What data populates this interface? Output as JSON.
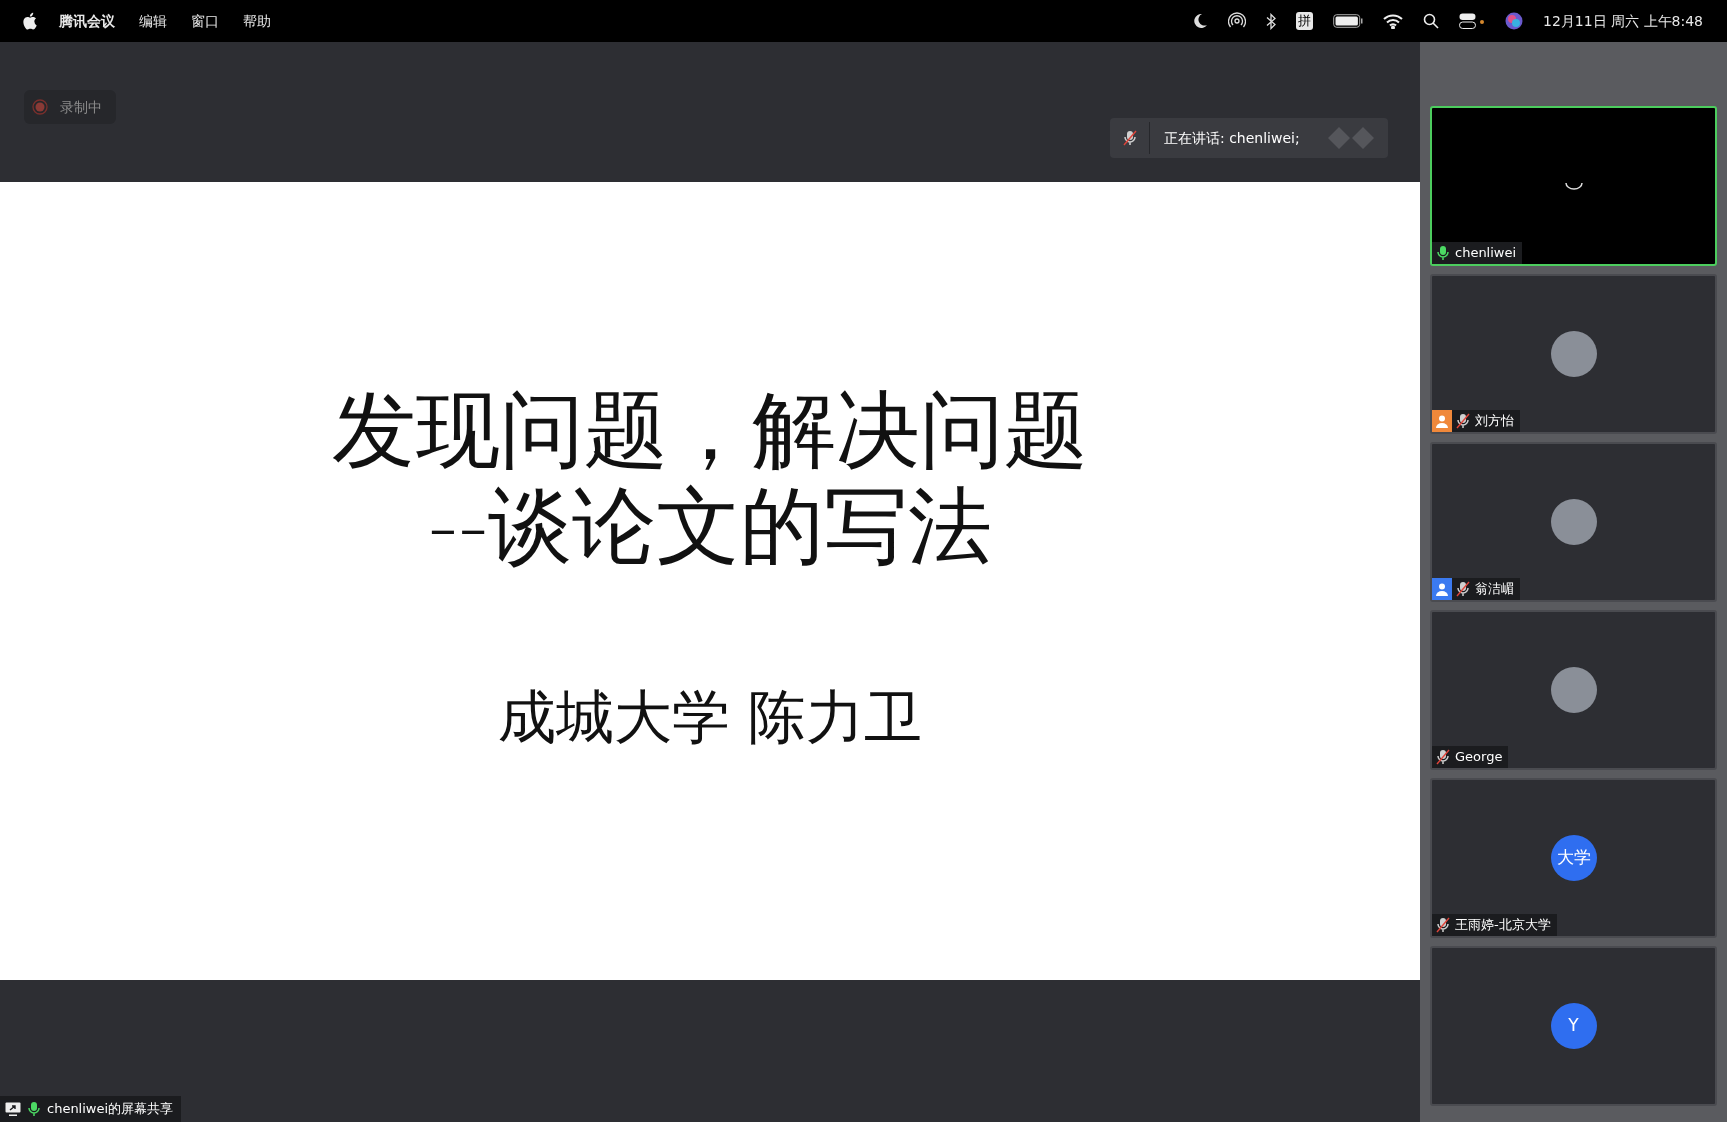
{
  "menubar": {
    "menus": [
      "腾讯会议",
      "编辑",
      "窗口",
      "帮助"
    ],
    "input_method": "拼",
    "clock": "12月11日 周六 上午8:48"
  },
  "recording": {
    "label": "录制中"
  },
  "speaking_banner": {
    "text": "正在讲话: chenliwei;",
    "muted": true
  },
  "slide": {
    "title_lines": [
      "发现问题，解决问题",
      "--谈论文的写法"
    ],
    "subtitle": "成城大学 陈力卫"
  },
  "participants": [
    {
      "kind": "video",
      "name": "chenliwei",
      "muted": false,
      "selected": true
    },
    {
      "kind": "photo",
      "name": "刘方怡",
      "muted": true,
      "selected": false,
      "color": "#f0883a"
    },
    {
      "kind": "photo",
      "name": "翁洁嵋",
      "muted": true,
      "selected": false,
      "color": "#3b7af0"
    },
    {
      "kind": "photo",
      "name": "George",
      "muted": true,
      "selected": false
    },
    {
      "kind": "initials",
      "initials": "大学",
      "name": "王雨婷-北京大学",
      "muted": true,
      "selected": false
    },
    {
      "kind": "initials",
      "initials": "Y",
      "selected": false
    }
  ],
  "share_label": {
    "text": "chenliwei的屏幕共享",
    "muted": false
  }
}
